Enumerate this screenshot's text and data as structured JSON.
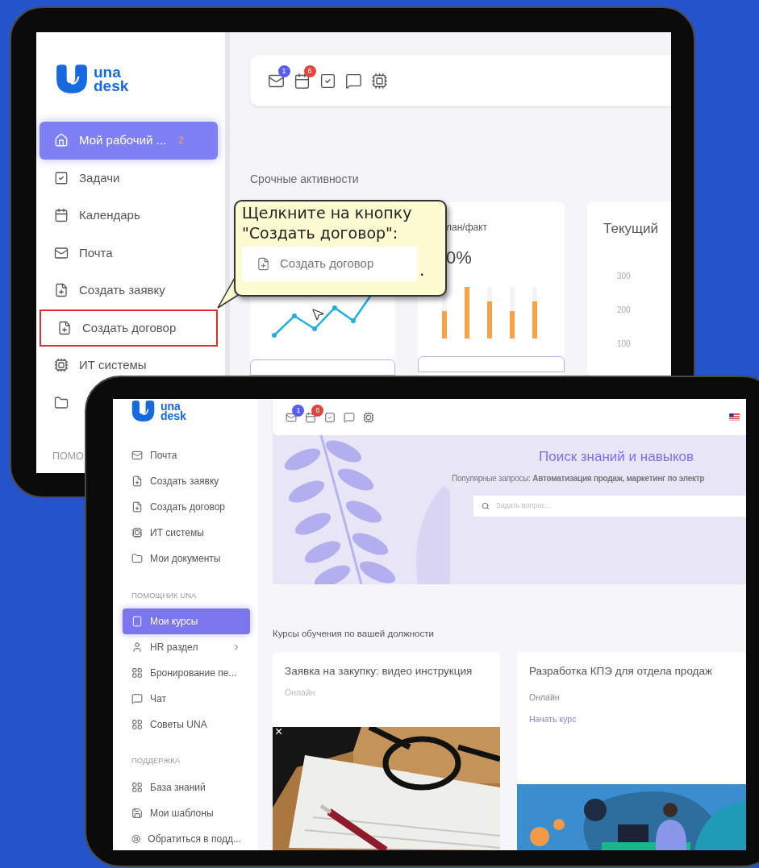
{
  "top_tablet": {
    "logo": {
      "line_1": "una",
      "line_2": "desk"
    },
    "sidebar": {
      "items": [
        {
          "label": "Мой рабочий ...",
          "badge": "2",
          "selected": true,
          "highlighted": false
        },
        {
          "label": "Задачи",
          "selected": false,
          "highlighted": false
        },
        {
          "label": "Календарь",
          "selected": false,
          "highlighted": false
        },
        {
          "label": "Почта",
          "selected": false,
          "highlighted": false
        },
        {
          "label": "Создать заявку",
          "selected": false,
          "highlighted": false
        },
        {
          "label": "Создать договор",
          "selected": false,
          "highlighted": true
        },
        {
          "label": "ИТ системы",
          "selected": false,
          "highlighted": false
        }
      ],
      "section_label": "ПОМО"
    },
    "toolbar": {
      "badges": [
        {
          "text": "1",
          "color": "#5b5cf0"
        },
        {
          "text": "6",
          "color": "#e8423f"
        }
      ]
    },
    "section_title": "Срочные активности",
    "cards": [
      {
        "kind": "line"
      },
      {
        "kind": "bars",
        "title": "лан/факт",
        "value": "0%"
      },
      {
        "kind": "axis",
        "title": "Текущий",
        "ticks": [
          "300",
          "200",
          "100"
        ]
      }
    ],
    "tooltip": {
      "text": "Щелкните на кнопку\n\"Создать договор\":",
      "button": "Создать договор",
      "trailing": "."
    }
  },
  "bottom_tablet": {
    "logo": {
      "line_1": "una",
      "line_2": "desk"
    },
    "sidebar": {
      "groups": [
        {
          "items": [
            {
              "label": "Почта",
              "selected": false
            },
            {
              "label": "Создать заявку",
              "selected": false
            },
            {
              "label": "Создать договор",
              "selected": false
            },
            {
              "label": "ИТ системы",
              "selected": false
            },
            {
              "label": "Мои документы",
              "selected": false
            }
          ]
        },
        {
          "title": "ПОМОЩНИК UNA",
          "items": [
            {
              "label": "Мои курсы",
              "selected": true
            },
            {
              "label": "HR раздел",
              "selected": false,
              "submenu": true
            },
            {
              "label": "Бронирование пе...",
              "selected": false
            },
            {
              "label": "Чат",
              "selected": false
            },
            {
              "label": "Советы UNA",
              "selected": false
            }
          ]
        },
        {
          "title": "ПОДДЕРЖКА",
          "items": [
            {
              "label": "База знаний",
              "selected": false
            },
            {
              "label": "Мои шаблоны",
              "selected": false
            },
            {
              "label": "Обратиться в подд...",
              "selected": false
            }
          ]
        }
      ]
    },
    "toolbar": {
      "badges": [
        {
          "text": "1",
          "color": "#5b5cf0"
        },
        {
          "text": "6",
          "color": "#e8423f"
        }
      ]
    },
    "hero": {
      "title": "Поиск знаний и навыков",
      "popular": "Популярные запросы: **Автоматизация продаж, маркетинг по электр**",
      "search_placeholder": "Задать вопрос..."
    },
    "courses_title": "Курсы обучения по вашей должности",
    "courses": [
      {
        "title": "Заявка на закупку: видео инструкция",
        "format": "Онлайн",
        "close": "×"
      },
      {
        "title": "Разработка КПЭ для отдела продаж",
        "format": "Онлайн",
        "link": "Начать курс"
      }
    ]
  }
}
